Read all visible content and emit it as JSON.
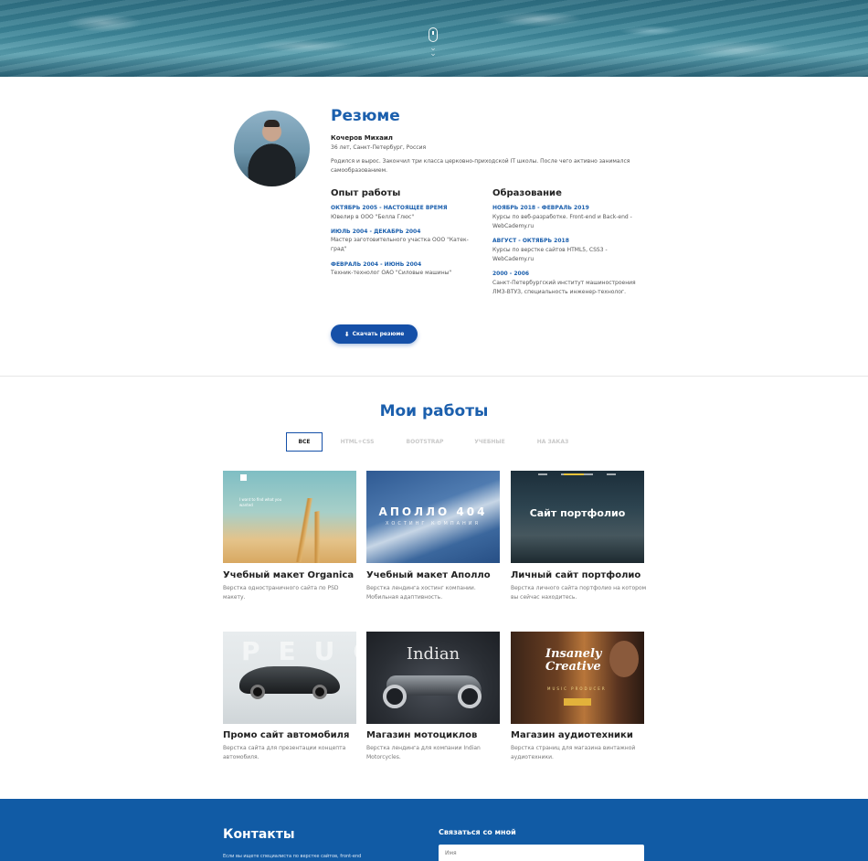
{
  "hero": {
    "scroll_icon": "mouse-scroll-icon",
    "chevron_icon": "chevron-down-icon"
  },
  "resume": {
    "title": "Резюме",
    "name": "Кочеров Михаил",
    "info": "36 лет, Санкт-Петербург, Россия",
    "bio": "Родился и вырос. Закончил три класса церковно-приходской IT школы. После чего активно занимался самообразованием.",
    "experience": {
      "title": "Опыт работы",
      "entries": [
        {
          "date": "Октябрь 2005 - настоящее время",
          "text": "Ювелир в ООО \"Белла Глюс\""
        },
        {
          "date": "Июль 2004 - Декабрь 2004",
          "text": "Мастер заготовительного участка ООО \"Катек-град\""
        },
        {
          "date": "Февраль 2004 - Июнь 2004",
          "text": "Техник-технолог ОАО \"Силовые машины\""
        }
      ]
    },
    "education": {
      "title": "Образование",
      "entries": [
        {
          "date": "Ноябрь 2018 - Февраль 2019",
          "text": "Курсы по веб-разработке. Front-end и Back-end - WebCademy.ru"
        },
        {
          "date": "Август - Октябрь 2018",
          "text": "Курсы по верстке сайтов HTML5, CSS3 - WebCademy.ru"
        },
        {
          "date": "2000 - 2006",
          "text": "Санкт-Петербургский институт машиностроения ЛМЗ-ВТУЗ, специальность инженер-технолог."
        }
      ]
    },
    "download_label": "Скачать резюме",
    "download_icon": "download-icon"
  },
  "works": {
    "title": "Мои работы",
    "filters": [
      "все",
      "html+css",
      "bootstrap",
      "учебные",
      "на заказ"
    ],
    "active_filter": "все",
    "cards": [
      {
        "title": "Учебный макет Organica",
        "desc": "Верстка одностраничного сайта по PSD макету.",
        "thumb_text": "I want to find what you wanted"
      },
      {
        "title": "Учебный макет Аполло",
        "desc": "Верстка лендинга хостинг компании. Мобильная адаптивность.",
        "thumb_text": "АПОЛЛО 404",
        "thumb_sub": "ХОСТИНГ КОМПАНИЯ"
      },
      {
        "title": "Личный сайт портфолио",
        "desc": "Верстка личного сайта портфолио на котором вы сейчас находитесь.",
        "thumb_text": "Сайт портфолио"
      },
      {
        "title": "Промо сайт автомобиля",
        "desc": "Верстка сайта для презентации концепта автомобиля.",
        "thumb_text": "PEUGEOT"
      },
      {
        "title": "Магазин мотоциклов",
        "desc": "Верстка лендинга для компании Indian Motorcycles.",
        "thumb_text": "Indian"
      },
      {
        "title": "Магазин аудиотехники",
        "desc": "Верстка страниц для магазина винтажной аудиотехники.",
        "thumb_text": "Insanely Creative",
        "thumb_sub": "MUSIC PRODUCER"
      }
    ]
  },
  "footer": {
    "contacts_title": "Контакты",
    "contacts_text": "Если вы ищете специалиста по верстке сайтов, front-end",
    "form_title": "Связаться со мной",
    "name_placeholder": "Имя"
  },
  "colors": {
    "accent": "#1b5fad",
    "button": "#1550a8",
    "footer": "#115ba5"
  }
}
